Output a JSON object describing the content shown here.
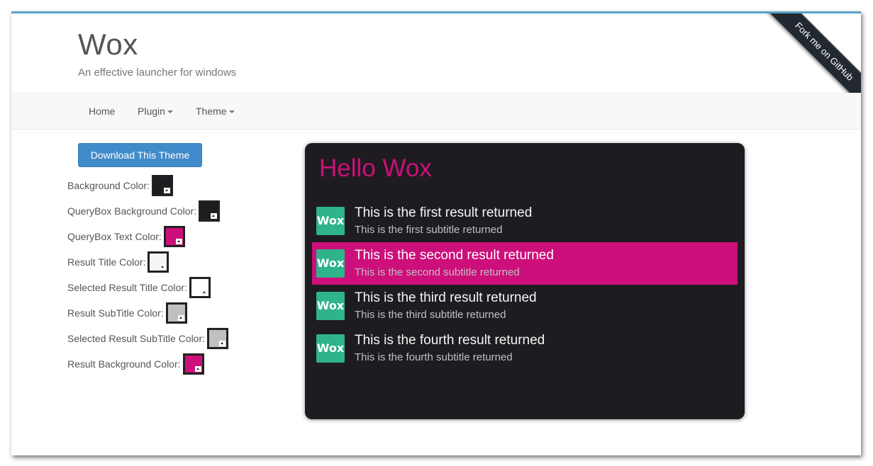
{
  "header": {
    "title": "Wox",
    "subtitle": "An effective launcher for windows",
    "ribbon": "Fork me on GitHub"
  },
  "nav": {
    "items": [
      {
        "label": "Home",
        "dropdown": false
      },
      {
        "label": "Plugin",
        "dropdown": true
      },
      {
        "label": "Theme",
        "dropdown": true
      }
    ]
  },
  "download_button": "Download This Theme",
  "colors": [
    {
      "label": "Background Color:",
      "value": "#1f1c21"
    },
    {
      "label": "QueryBox Background Color:",
      "value": "#1f1c21"
    },
    {
      "label": "QueryBox Text Color:",
      "value": "#cc0f7a"
    },
    {
      "label": "Result Title Color:",
      "value": "#f5f5f5"
    },
    {
      "label": "Selected Result Title Color:",
      "value": "#ffffff"
    },
    {
      "label": "Result SubTitle Color:",
      "value": "#c0c0c0"
    },
    {
      "label": "Selected Result SubTitle Color:",
      "value": "#c0c0c0"
    },
    {
      "label": "Result Background Color:",
      "value": "#cc0f7a"
    }
  ],
  "preview": {
    "query": "Hello Wox",
    "icon_text": "Wox",
    "icon_color": "#2fb38b",
    "selected_index": 1,
    "results": [
      {
        "title": "This is the first result returned",
        "subtitle": "This is the first subtitle returned"
      },
      {
        "title": "This is the second result returned",
        "subtitle": "This is the second subtitle returned"
      },
      {
        "title": "This is the third result returned",
        "subtitle": "This is the third subtitle returned"
      },
      {
        "title": "This is the fourth result returned",
        "subtitle": "This is the fourth subtitle returned"
      }
    ]
  }
}
